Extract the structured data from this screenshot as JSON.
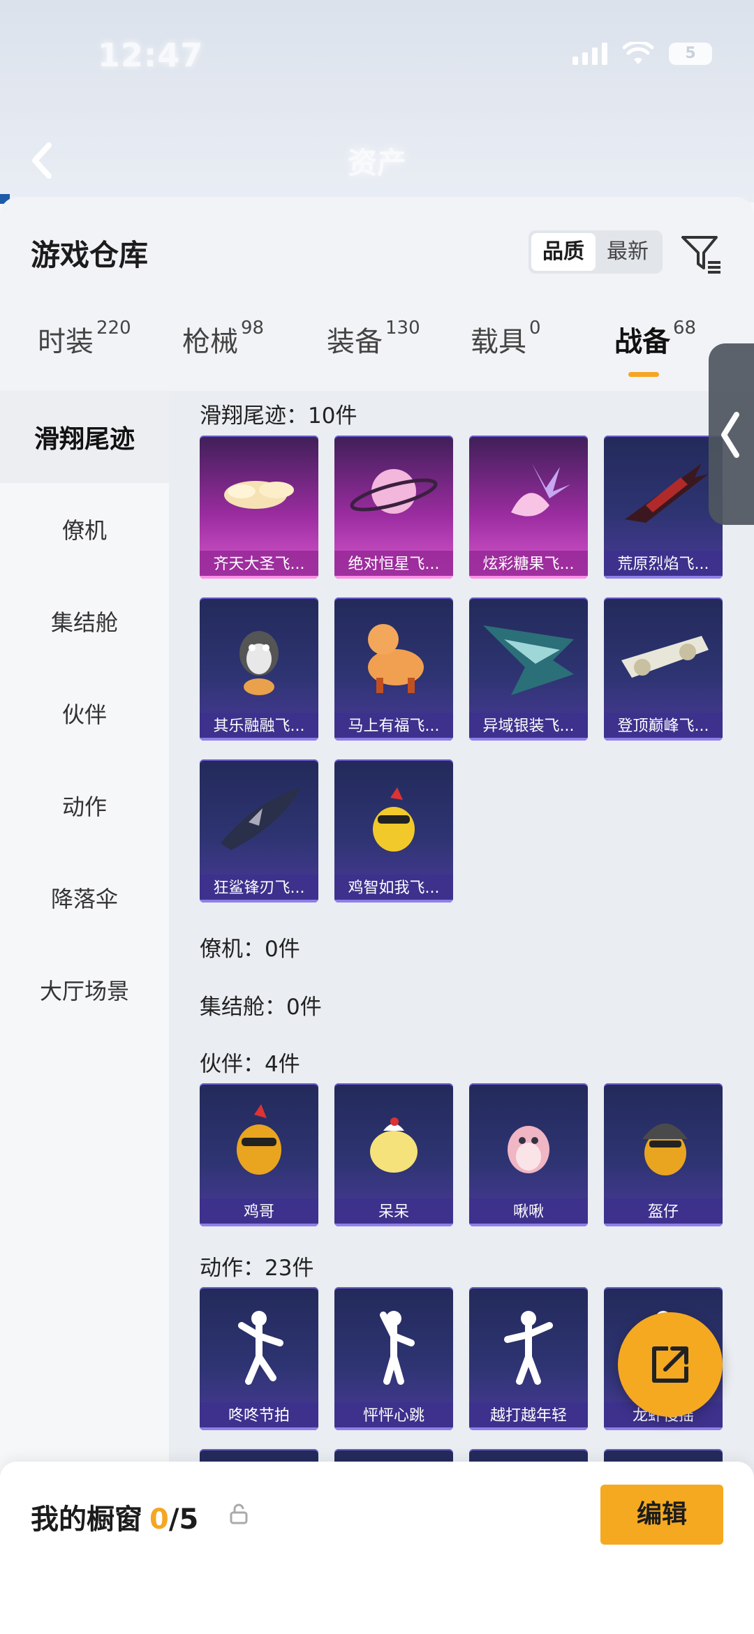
{
  "status_bar": {
    "time": "12:47",
    "battery": "5"
  },
  "nav": {
    "title": "资产"
  },
  "header": {
    "title": "游戏仓库",
    "sort_options": [
      "品质",
      "最新"
    ],
    "sort_active": "品质"
  },
  "tabs": [
    {
      "label": "时装",
      "count": "220"
    },
    {
      "label": "枪械",
      "count": "98"
    },
    {
      "label": "装备",
      "count": "130"
    },
    {
      "label": "载具",
      "count": "0"
    },
    {
      "label": "战备",
      "count": "68",
      "active": true
    }
  ],
  "sidebar": [
    "滑翔尾迹",
    "僚机",
    "集结舱",
    "伙伴",
    "动作",
    "降落伞",
    "大厅场景"
  ],
  "sections": {
    "glide": {
      "title": "滑翔尾迹：10件",
      "items": [
        "齐天大圣飞...",
        "绝对恒星飞...",
        "炫彩糖果飞...",
        "荒原烈焰飞...",
        "其乐融融飞...",
        "马上有福飞...",
        "异域银装飞...",
        "登顶巅峰飞...",
        "狂鲨锋刃飞...",
        "鸡智如我飞..."
      ]
    },
    "wingman": {
      "title": "僚机：0件"
    },
    "pod": {
      "title": "集结舱：0件"
    },
    "partner": {
      "title": "伙伴：4件",
      "items": [
        "鸡哥",
        "呆呆",
        "啾啾",
        "盔仔"
      ]
    },
    "emote": {
      "title": "动作：23件",
      "items": [
        "咚咚节拍",
        "怦怦心跳",
        "越打越年轻",
        "龙虾慢摇"
      ]
    }
  },
  "bottom": {
    "label": "我的橱窗",
    "current": "0",
    "total": "/5",
    "edit": "编辑"
  },
  "colors": {
    "accent": "#f5a623",
    "card_purple": "#2e3472",
    "card_pink": "#9a2c9f"
  }
}
